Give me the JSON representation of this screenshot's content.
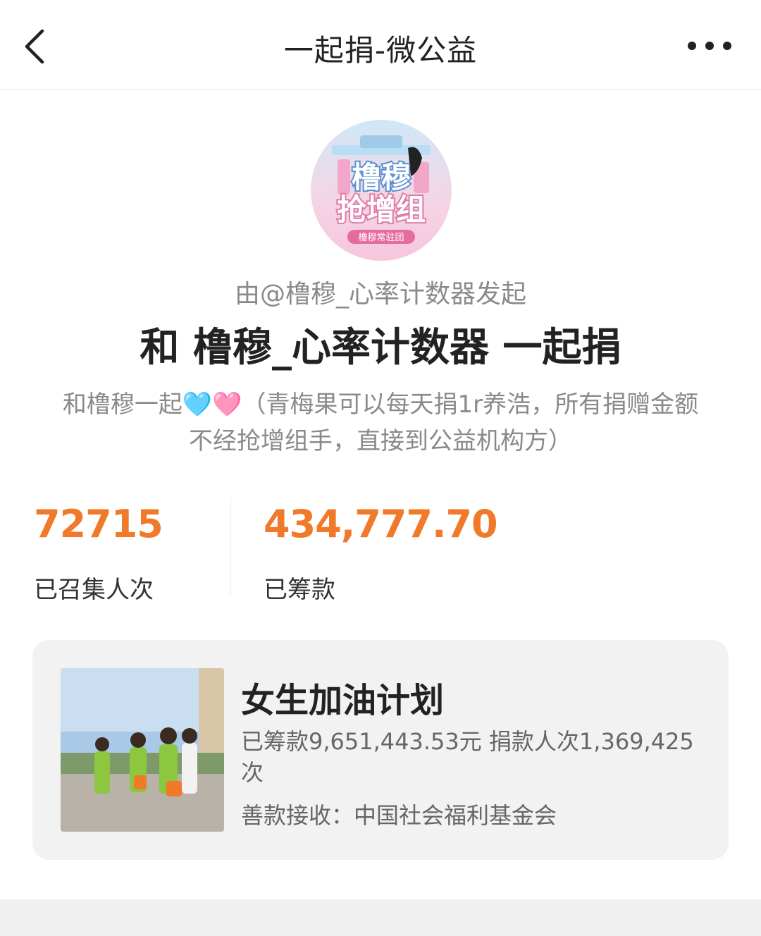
{
  "nav": {
    "title": "一起捐-微公益",
    "back_icon": "chevron-left-icon",
    "more_icon": "more-dots-icon"
  },
  "campaign": {
    "avatar_text_line1": "橹穆",
    "avatar_text_line2": "抢增组",
    "avatar_badge": "橹穆常驻团",
    "initiator": "由@橹穆_心率计数器发起",
    "headline": "和 橹穆_心率计数器 一起捐",
    "description": "和橹穆一起🩵🩷（青梅果可以每天捐1r养浩，所有捐赠金额不经抢增组手，直接到公益机构方）"
  },
  "stats": {
    "participants_value": "72715",
    "participants_label": "已召集人次",
    "raised_value": "434,777.70",
    "raised_label": "已筹款"
  },
  "project": {
    "name": "女生加油计划",
    "stats_text": "已筹款9,651,443.53元  捐款人次1,369,425次",
    "receiver": "善款接收：中国社会福利基金会"
  },
  "colors": {
    "accent": "#f07a2a",
    "card_bg": "#f2f2f2",
    "muted_text": "#8a8a8a"
  }
}
